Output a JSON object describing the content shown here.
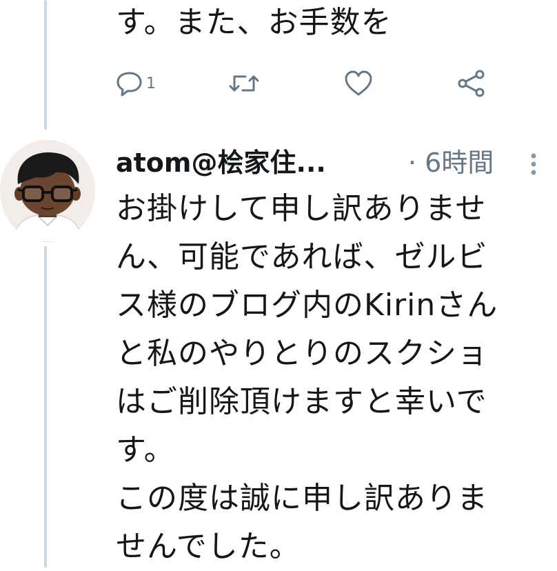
{
  "previous_tweet": {
    "text_tail": "す。また、お手数を",
    "actions": {
      "reply_count": "1"
    }
  },
  "reply_tweet": {
    "display_name": "atom@桧家住...",
    "timestamp": "· 6時間",
    "body_lines": [
      "お掛けして申し訳ありませ",
      "ん、可能であれば、ゼルビ",
      "ス様のブログ内のKirinさん",
      "と私のやりとりのスクショ",
      "はご削除頂けますと幸いで",
      "す。",
      "この度は誠に申し訳ありま",
      "せんでした。"
    ]
  },
  "colors": {
    "text": "#14171a",
    "secondary": "#657786",
    "thread_line": "#ccd6dd"
  },
  "icons": [
    "reply-icon",
    "retweet-icon",
    "like-icon",
    "share-icon",
    "more-icon"
  ]
}
